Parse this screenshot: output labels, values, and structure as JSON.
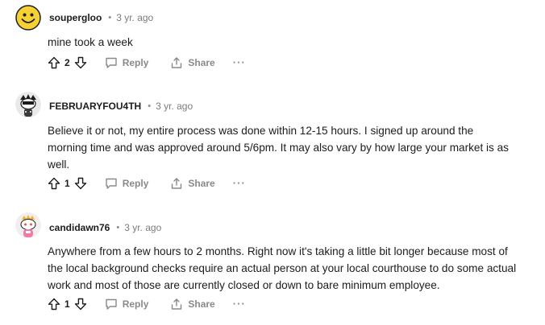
{
  "comments": [
    {
      "author": "soupergloo",
      "separator": "•",
      "time": "3 yr. ago",
      "body": [
        "mine took a week"
      ],
      "score": "2",
      "reply_label": "Reply",
      "share_label": "Share",
      "more_label": "···",
      "avatar_icon": "smiley-avatar-icon"
    },
    {
      "author": "FEBRUARYFOU4TH",
      "separator": "•",
      "time": "3 yr. ago",
      "body": [
        "Believe it or not, my entire process was done within 12-15 hours. I signed up around the",
        "morning time and was approved around 5/6pm. It may also vary by how large your market is as",
        "well."
      ],
      "score": "1",
      "reply_label": "Reply",
      "share_label": "Share",
      "more_label": "···",
      "avatar_icon": "snoo-avatar-icon"
    },
    {
      "author": "candidawn76",
      "separator": "•",
      "time": "3 yr. ago",
      "body": [
        "Anywhere from a few hours to 2 months. Right now it's taking a little bit longer because most of",
        "the local background checks require an actual person at your local courthouse to do some actual",
        "work and most of those are currently closed or down to bare minimum employee."
      ],
      "score": "1",
      "reply_label": "Reply",
      "share_label": "Share",
      "more_label": "···",
      "avatar_icon": "snoo-avatar-icon"
    }
  ],
  "colors": {
    "text": "#1c1c1c",
    "meta": "#7c7c7c",
    "action": "#878a8c",
    "avatar_yellow": "#f5d133"
  }
}
